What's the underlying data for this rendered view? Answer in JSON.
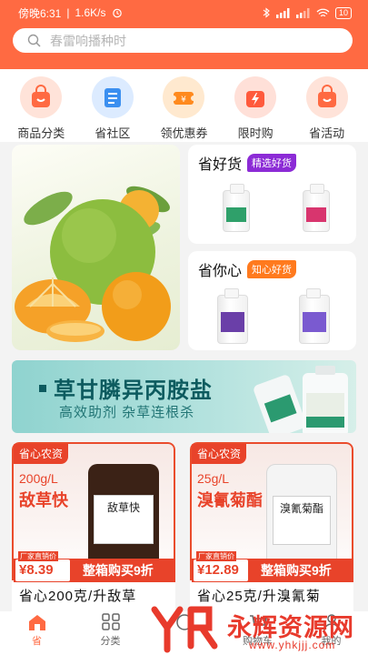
{
  "status_bar": {
    "time": "傍晚6:31",
    "speed": "1.6K/s",
    "battery": "10"
  },
  "search": {
    "placeholder": "春雷响播种时"
  },
  "categories": [
    {
      "label": "商品分类",
      "color": "#ff6a42"
    },
    {
      "label": "省社区",
      "color": "#3b8ff0"
    },
    {
      "label": "领优惠券",
      "color": "#ff8a1e"
    },
    {
      "label": "限时购",
      "color": "#ff5a3c"
    },
    {
      "label": "省活动",
      "color": "#ff6a42"
    }
  ],
  "promo_cards": {
    "good": {
      "title": "省好货",
      "tag": "精选好货",
      "tag_color": "#8c2bd6"
    },
    "heart": {
      "title": "省你心",
      "tag": "知心好货",
      "tag_color": "#ff7a1e"
    }
  },
  "banner": {
    "headline": "草甘膦异丙胺盐",
    "sub": "高效助剂 杂草连根杀"
  },
  "products": [
    {
      "brand": "省心农资",
      "spec": "200g/L",
      "name": "敌草快",
      "jar_label": "敌草快",
      "price_label": "厂家直销价",
      "price": "¥8.39",
      "discount": "整箱购买9折",
      "title": "省心200克/升敌草",
      "jar_color": "#3b2216"
    },
    {
      "brand": "省心农资",
      "spec": "25g/L",
      "name": "溴氰菊酯",
      "jar_label": "溴氰菊酯",
      "price_label": "厂家直销价",
      "price": "¥12.89",
      "discount": "整箱购买9折",
      "title": "省心25克/升溴氰菊",
      "jar_color": "#f4f4f4"
    }
  ],
  "bottom_nav": [
    {
      "label": "省",
      "active": true
    },
    {
      "label": "分类",
      "active": false
    },
    {
      "label": "",
      "active": false
    },
    {
      "label": "购物车",
      "active": false
    },
    {
      "label": "我的",
      "active": false
    }
  ],
  "watermark": {
    "title": "永辉资源网",
    "url": "www.yhkjjj.com"
  }
}
